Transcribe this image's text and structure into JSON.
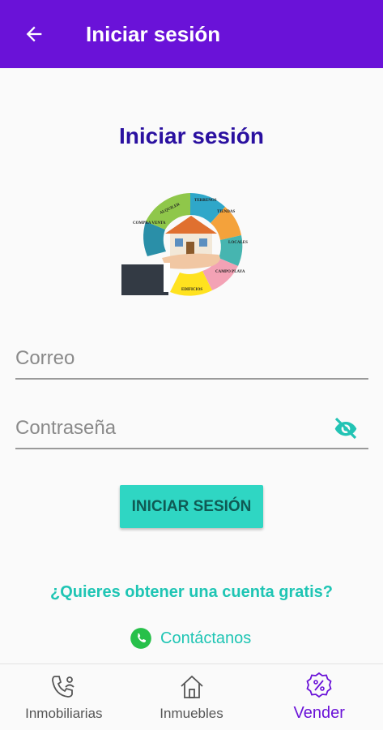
{
  "appbar": {
    "title": "Iniciar sesión",
    "back_icon": "arrow-left-icon",
    "color": "#6a12d8"
  },
  "page": {
    "heading": "Iniciar sesión"
  },
  "logo": {
    "segments": [
      "ALQUILER",
      "TERRENOS",
      "TIENDAS",
      "LOCALES",
      "CAMPO PLAYA",
      "EDIFICIOS",
      "COMPRA VENTA"
    ]
  },
  "form": {
    "email_placeholder": "Correo",
    "password_placeholder": "Contraseña",
    "toggle_icon": "eye-off-icon"
  },
  "login_button": "INICIAR SESIÓN",
  "free_account_link": "¿Quieres obtener una cuenta gratis?",
  "contact": {
    "label": "Contáctanos",
    "icon": "whatsapp-icon"
  },
  "bottom_nav": {
    "items": [
      {
        "label": "Inmobiliarias",
        "icon": "phone-contacts-icon"
      },
      {
        "label": "Inmuebles",
        "icon": "house-icon"
      },
      {
        "label": "Vender",
        "icon": "discount-badge-icon",
        "active": true
      }
    ]
  },
  "colors": {
    "primary": "#6a12d8",
    "accent": "#2fd6c3",
    "heading": "#2a10a0"
  }
}
